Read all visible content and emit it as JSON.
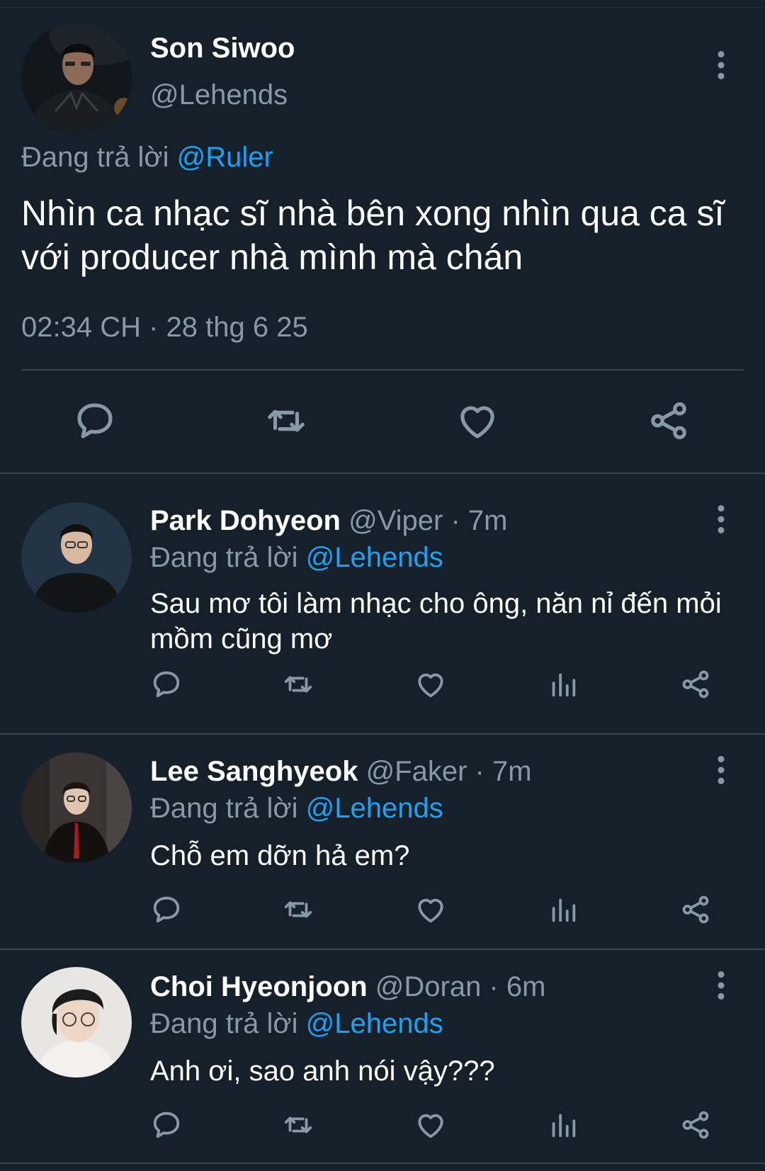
{
  "main_tweet": {
    "name": "Son Siwoo",
    "handle": "@Lehends",
    "replying_prefix": "Đang trả lời",
    "replying_to": "@Ruler",
    "text": "Nhìn ca nhạc sĩ nhà bên xong nhìn qua ca sĩ với producer nhà mình mà chán",
    "timestamp": "02:34 CH · 28 thg 6 25",
    "actions": [
      "reply-icon",
      "retweet-icon",
      "like-icon",
      "share-icon"
    ]
  },
  "replies": [
    {
      "name": "Park Dohyeon",
      "meta": "@Viper · 7m",
      "replying_prefix": "Đang trả lời",
      "replying_to": "@Lehends",
      "text": "Sau mơ tôi làm nhạc cho ông, năn nỉ đến mỏi mồm cũng mơ",
      "actions": [
        "reply-icon",
        "retweet-icon",
        "like-icon",
        "analytics-icon",
        "share-icon"
      ]
    },
    {
      "name": "Lee Sanghyeok",
      "meta": "@Faker · 7m",
      "replying_prefix": "Đang trả lời",
      "replying_to": "@Lehends",
      "text": "Chỗ em dỡn hả em?",
      "actions": [
        "reply-icon",
        "retweet-icon",
        "like-icon",
        "analytics-icon",
        "share-icon"
      ]
    },
    {
      "name": "Choi Hyeonjoon",
      "meta": "@Doran · 6m",
      "replying_prefix": "Đang trả lời",
      "replying_to": "@Lehends",
      "text": "Anh ơi, sao anh nói vậy???",
      "actions": [
        "reply-icon",
        "retweet-icon",
        "like-icon",
        "analytics-icon",
        "share-icon"
      ]
    }
  ],
  "colors": {
    "background": "#15202b",
    "divider": "#38444d",
    "secondary_text": "#8899a6",
    "mention": "#1da1f2",
    "primary_text": "#ffffff"
  }
}
